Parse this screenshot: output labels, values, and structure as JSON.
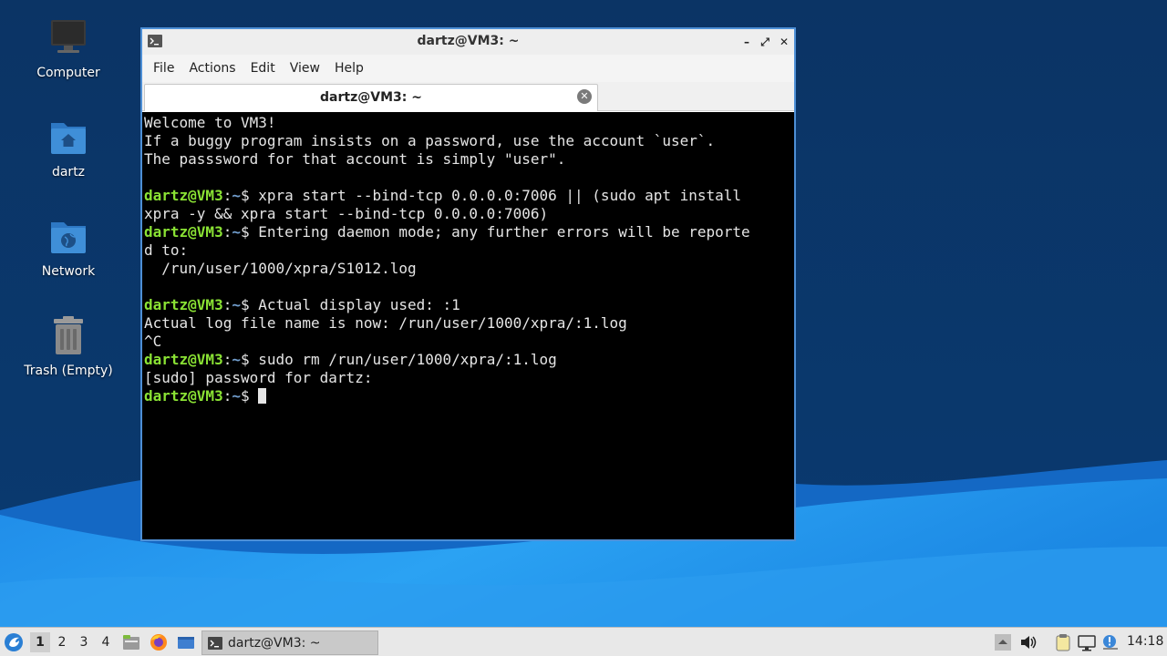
{
  "desktop": {
    "icons": [
      {
        "label": "Computer"
      },
      {
        "label": "dartz"
      },
      {
        "label": "Network"
      },
      {
        "label": "Trash (Empty)"
      }
    ],
    "colors": {
      "folder": "#3f8fd8",
      "wave": "#2a9af0"
    }
  },
  "window": {
    "title": "dartz@VM3: ~",
    "buttons": {
      "minimize": "–",
      "maximize": "⤢",
      "close": "✕"
    },
    "menu": [
      "File",
      "Actions",
      "Edit",
      "View",
      "Help"
    ],
    "tab": {
      "label": "dartz@VM3: ~",
      "close": "✕"
    }
  },
  "terminal": {
    "prompt_user": "dartz@VM3",
    "prompt_sep": ":",
    "prompt_dir": "~",
    "prompt_end": "$ ",
    "lines": [
      {
        "text": "Welcome to VM3!"
      },
      {
        "text": "If a buggy program insists on a password, use the account `user`."
      },
      {
        "text": "The passsword for that account is simply \"user\"."
      },
      {
        "text": ""
      },
      {
        "prompt": true,
        "text": "xpra start --bind-tcp 0.0.0.0:7006 || (sudo apt install"
      },
      {
        "text": "xpra -y && xpra start --bind-tcp 0.0.0.0:7006)"
      },
      {
        "prompt": true,
        "text": "Entering daemon mode; any further errors will be reporte"
      },
      {
        "text": "d to:"
      },
      {
        "text": "  /run/user/1000/xpra/S1012.log"
      },
      {
        "text": ""
      },
      {
        "prompt": true,
        "text": "Actual display used: :1"
      },
      {
        "text": "Actual log file name is now: /run/user/1000/xpra/:1.log"
      },
      {
        "text": "^C"
      },
      {
        "prompt": true,
        "text": "sudo rm /run/user/1000/xpra/:1.log"
      },
      {
        "text": "[sudo] password for dartz:"
      },
      {
        "prompt": true,
        "text": "",
        "cursor": true
      }
    ],
    "colors": {
      "background": "#000000",
      "text": "#e5e5e5",
      "prompt": "#8ae234",
      "path": "#729fcf"
    }
  },
  "taskbar": {
    "workspaces": [
      "1",
      "2",
      "3",
      "4"
    ],
    "active_workspace": "1",
    "task_label": "dartz@VM3: ~",
    "clock": "14:18",
    "tray_icons": [
      "up-arrow-icon",
      "volume-icon",
      "clipboard-icon",
      "network-icon",
      "update-notifier-icon"
    ]
  }
}
